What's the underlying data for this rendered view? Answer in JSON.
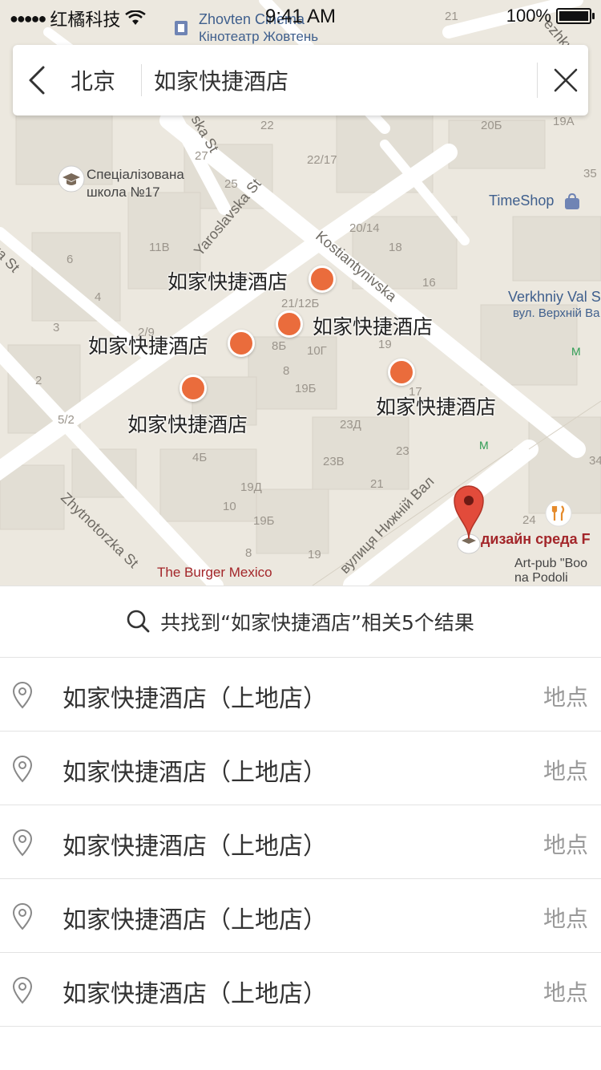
{
  "status_bar": {
    "signal": "●●●●●",
    "carrier": "红橘科技",
    "time": "9:41 AM",
    "battery": "100%"
  },
  "search": {
    "city": "北京",
    "query": "如家快捷酒店"
  },
  "map": {
    "markers": [
      {
        "label": "如家快捷酒店"
      },
      {
        "label": "如家快捷酒店"
      },
      {
        "label": "如家快捷酒店"
      },
      {
        "label": "如家快捷酒店"
      },
      {
        "label": "如家快捷酒店"
      }
    ],
    "poi": {
      "zhovten": "Zhovten Cinema",
      "zhovten_ua": "Кінотеатр Жовтень",
      "school_1": "Спеціалізована",
      "school_2": "школа №17",
      "timeshop": "TimeShop",
      "verkhniy_1": "Verkhniy Val S",
      "verkhniy_2": "вул. Верхній Ва",
      "dizain": "дизайн среда F",
      "artpub_1": "Art-pub \"Boo",
      "artpub_2": "na Podoli",
      "burger": "The Burger Mexico"
    },
    "streets": {
      "yaroslavska": "Yaroslavska St",
      "kostiantynivska": "Kostiantynivska",
      "nyzhnii_val": "вулиця Нижній Вал",
      "zhytnotorzka": "Zhytnotorzka St",
      "ska": "ska St",
      "ka_st": "ka St",
      "ezhky": "ezhky"
    },
    "house_numbers": [
      "21",
      "22",
      "20Б",
      "19А",
      "27",
      "22/17",
      "25",
      "35",
      "20/14",
      "18",
      "11В",
      "6",
      "16",
      "4",
      "21/12Б",
      "3",
      "8Б",
      "10Г",
      "19",
      "2/9",
      "8",
      "19Б",
      "17",
      "2",
      "5/2",
      "23Д",
      "23",
      "4Б",
      "23В",
      "21",
      "19Д",
      "10",
      "19Б",
      "8",
      "19",
      "24",
      "34"
    ]
  },
  "results": {
    "summary": "共找到“如家快捷酒店”相关5个结果",
    "items": [
      {
        "name": "如家快捷酒店（上地店）",
        "type": "地点"
      },
      {
        "name": "如家快捷酒店（上地店）",
        "type": "地点"
      },
      {
        "name": "如家快捷酒店（上地店）",
        "type": "地点"
      },
      {
        "name": "如家快捷酒店（上地店）",
        "type": "地点"
      },
      {
        "name": "如家快捷酒店（上地店）",
        "type": "地点"
      }
    ]
  }
}
